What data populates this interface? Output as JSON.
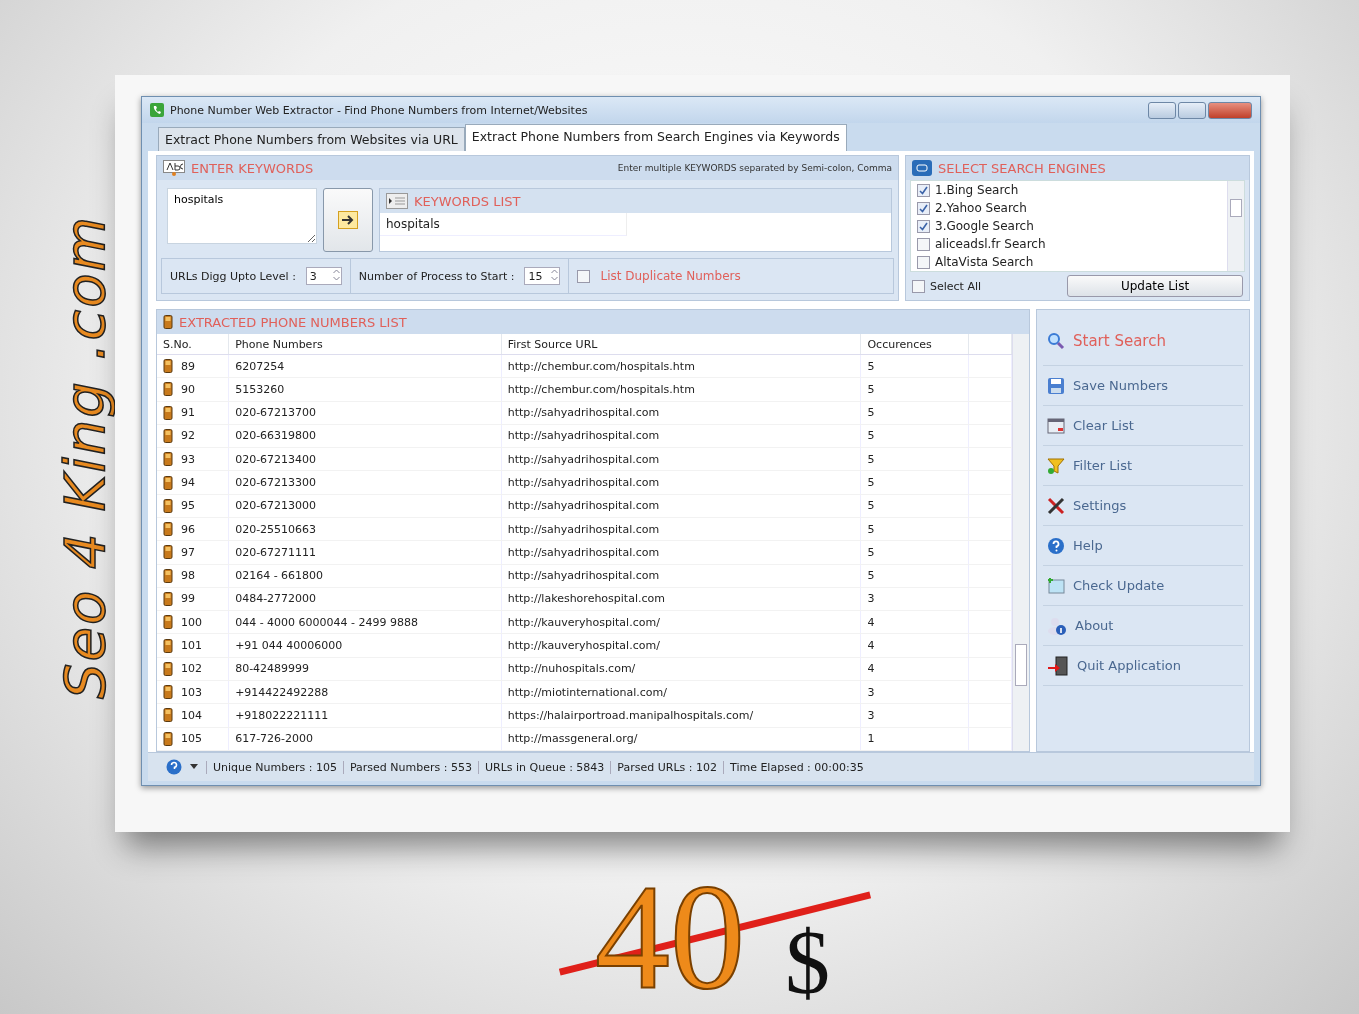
{
  "window": {
    "title": "Phone Number Web Extractor - Find Phone Numbers from Internet/Websites"
  },
  "tabs": [
    {
      "label": "Extract Phone Numbers from Websites via URL",
      "selected": false
    },
    {
      "label": "Extract Phone Numbers from Search Engines via Keywords",
      "selected": true
    }
  ],
  "keywords": {
    "header": "ENTER KEYWORDS",
    "hint": "Enter multiple KEYWORDS separated by Semi-colon, Comma",
    "input": "hospitals",
    "list_header": "KEYWORDS LIST",
    "list": [
      "hospitals"
    ]
  },
  "options": {
    "digg_label": "URLs Digg Upto Level :",
    "digg_value": "3",
    "process_label": "Number of Process to Start :",
    "process_value": "15",
    "duplicates": {
      "label": "List Duplicate Numbers",
      "checked": false
    }
  },
  "engines": {
    "header": "SELECT SEARCH ENGINES",
    "items": [
      {
        "label": "1.Bing Search",
        "checked": true
      },
      {
        "label": "2.Yahoo Search",
        "checked": true
      },
      {
        "label": "3.Google Search",
        "checked": true
      },
      {
        "label": "aliceadsl.fr Search",
        "checked": false
      },
      {
        "label": "AltaVista Search",
        "checked": false
      }
    ],
    "select_all": {
      "label": "Select All",
      "checked": false
    },
    "update_button": "Update List"
  },
  "results": {
    "header": "EXTRACTED PHONE NUMBERS LIST",
    "columns": [
      "S.No.",
      "Phone Numbers",
      "First Source URL",
      "Occurences"
    ],
    "rows": [
      [
        "89",
        "6207254",
        "http://chembur.com/hospitals.htm",
        "5"
      ],
      [
        "90",
        "5153260",
        "http://chembur.com/hospitals.htm",
        "5"
      ],
      [
        "91",
        "020-67213700",
        "http://sahyadrihospital.com",
        "5"
      ],
      [
        "92",
        "020-66319800",
        "http://sahyadrihospital.com",
        "5"
      ],
      [
        "93",
        "020-67213400",
        "http://sahyadrihospital.com",
        "5"
      ],
      [
        "94",
        "020-67213300",
        "http://sahyadrihospital.com",
        "5"
      ],
      [
        "95",
        "020-67213000",
        "http://sahyadrihospital.com",
        "5"
      ],
      [
        "96",
        "020-25510663",
        "http://sahyadrihospital.com",
        "5"
      ],
      [
        "97",
        "020-67271111",
        "http://sahyadrihospital.com",
        "5"
      ],
      [
        "98",
        "02164 - 661800",
        "http://sahyadrihospital.com",
        "5"
      ],
      [
        "99",
        "0484-2772000",
        "http://lakeshorehospital.com",
        "3"
      ],
      [
        "100",
        "044 - 4000 6000044 - 2499 9888",
        "http://kauveryhospital.com/",
        "4"
      ],
      [
        "101",
        "+91 044 40006000",
        "http://kauveryhospital.com/",
        "4"
      ],
      [
        "102",
        "80-42489999",
        "http://nuhospitals.com/",
        "4"
      ],
      [
        "103",
        "+914422492288",
        "http://miotinternational.com/",
        "3"
      ],
      [
        "104",
        "+918022221111",
        "https://halairportroad.manipalhospitals.com/",
        "3"
      ],
      [
        "105",
        "617-726-2000",
        "http://massgeneral.org/",
        "1"
      ]
    ]
  },
  "actions": [
    {
      "label": "Start Search",
      "kind": "search"
    },
    {
      "label": "Save Numbers",
      "kind": "save"
    },
    {
      "label": "Clear List",
      "kind": "clear"
    },
    {
      "label": "Filter List",
      "kind": "filter"
    },
    {
      "label": "Settings",
      "kind": "settings"
    },
    {
      "label": "Help",
      "kind": "help"
    },
    {
      "label": "Check Update",
      "kind": "update"
    },
    {
      "label": "About",
      "kind": "about"
    },
    {
      "label": "Quit Application",
      "kind": "quit"
    }
  ],
  "status_bar": [
    {
      "label": "Unique Numbers :",
      "value": "105"
    },
    {
      "label": "Parsed Numbers :",
      "value": "553"
    },
    {
      "label": "URLs in Queue :",
      "value": "5843"
    },
    {
      "label": "Parsed URLs :",
      "value": "102"
    },
    {
      "label": "Time Elapsed :",
      "value": "00:00:35"
    }
  ],
  "promo": {
    "brand": "Seo 4 King .com",
    "price": "40",
    "struck_out": true,
    "currency": "$"
  }
}
